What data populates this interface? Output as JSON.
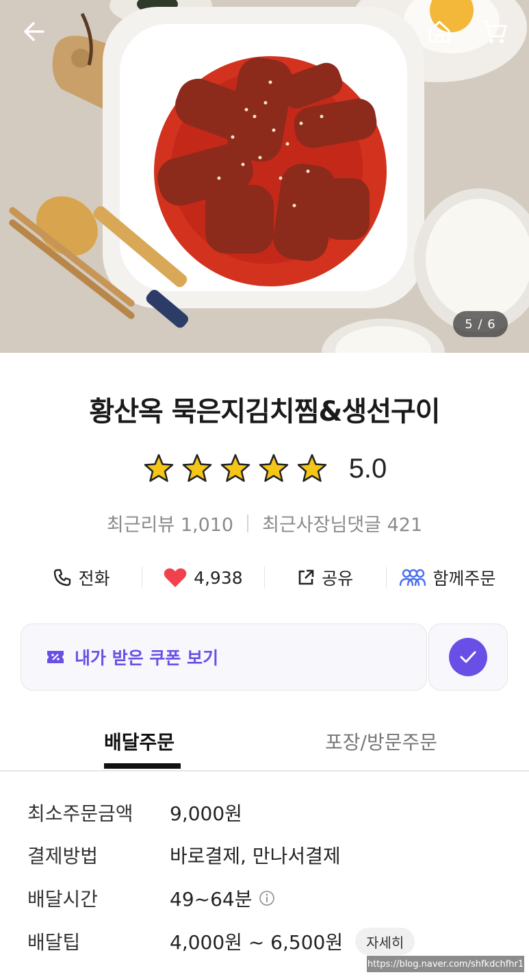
{
  "hero": {
    "image_counter": "5 / 6"
  },
  "header": {
    "back_icon": "arrow-left-icon",
    "home_icon": "home-icon",
    "cart_icon": "cart-icon"
  },
  "store": {
    "name": "황산옥 묵은지김치찜&생선구이",
    "rating": "5.0",
    "rating_stars": 5,
    "recent_reviews": "최근리뷰 1,010",
    "owner_comments": "최근사장님댓글 421"
  },
  "actions": {
    "call_label": "전화",
    "like_count": "4,938",
    "share_label": "공유",
    "group_order_label": "함께주문"
  },
  "coupon": {
    "label": "내가 받은 쿠폰 보기"
  },
  "tabs": {
    "delivery": "배달주문",
    "pickup": "포장/방문주문",
    "active": "배달주문"
  },
  "info": {
    "min_order_label": "최소주문금액",
    "min_order_value": "9,000원",
    "payment_label": "결제방법",
    "payment_value": "바로결제, 만나서결제",
    "delivery_time_label": "배달시간",
    "delivery_time_value": "49~64분",
    "tip_label": "배달팁",
    "tip_value": "4,000원 ~ 6,500원",
    "tip_detail_button": "자세히"
  },
  "watermark": "https://blog.naver.com/shfkdchfhr1",
  "colors": {
    "accent": "#6a4fe6",
    "heart": "#f0414f",
    "star": "#f5c518"
  }
}
